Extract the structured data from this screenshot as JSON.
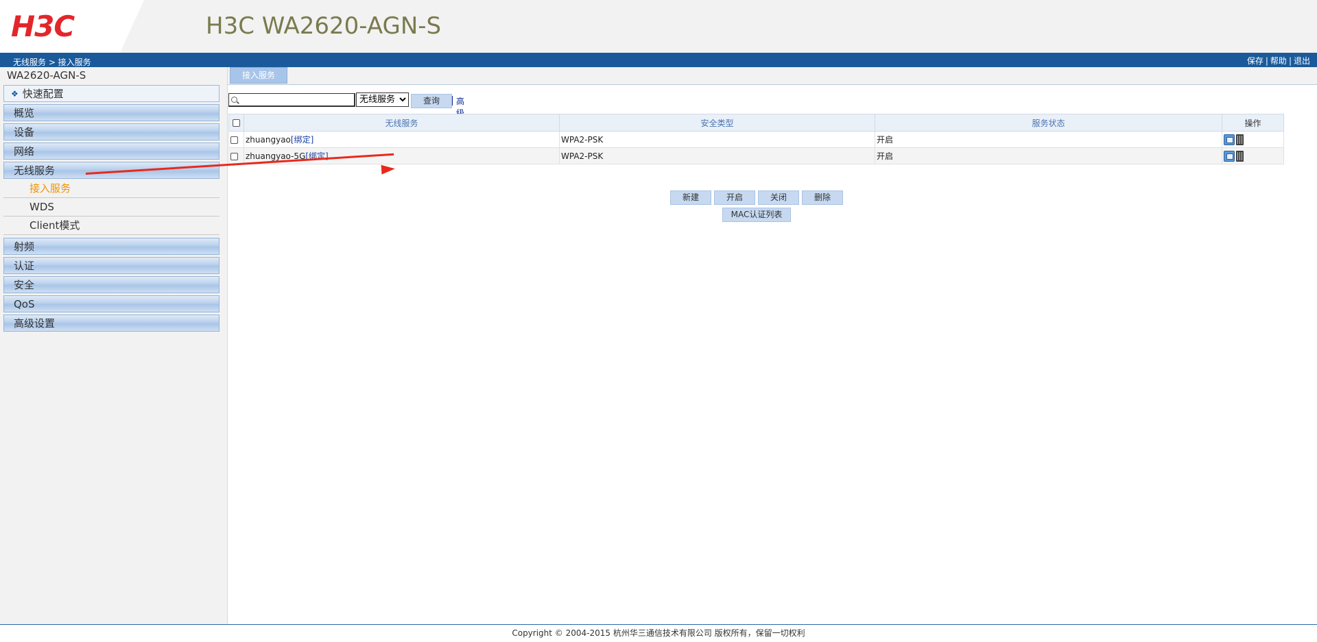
{
  "header": {
    "logo_text": "H3C",
    "title": "H3C WA2620-AGN-S",
    "breadcrumb": "无线服务 > 接入服务",
    "links": [
      "保存",
      "帮助",
      "退出"
    ]
  },
  "sidebar": {
    "device_name": "WA2620-AGN-S",
    "quick_config": "快速配置",
    "menu": {
      "overview": "概览",
      "device": "设备",
      "network": "网络",
      "wireless": "无线服务",
      "radio": "射频",
      "auth": "认证",
      "security": "安全",
      "qos": "QoS",
      "advanced": "高级设置"
    },
    "submenu": [
      "接入服务",
      "WDS",
      "Client模式"
    ],
    "active_submenu": "接入服务"
  },
  "main": {
    "tab": "接入服务",
    "search": {
      "value": "",
      "select_value": "无线服务",
      "query_button": "查询",
      "advanced_query": "高级查询"
    },
    "table": {
      "headers": [
        "无线服务",
        "安全类型",
        "服务状态",
        "操作"
      ],
      "rows": [
        {
          "service": "zhuangyao",
          "bind": "[绑定]",
          "security": "WPA2-PSK",
          "status": "开启"
        },
        {
          "service": "zhuangyao-5G",
          "bind": "[绑定]",
          "security": "WPA2-PSK",
          "status": "开启"
        }
      ]
    },
    "buttons": {
      "new": "新建",
      "enable": "开启",
      "disable": "关闭",
      "delete": "删除",
      "mac_list": "MAC认证列表"
    }
  },
  "footer": {
    "copyright": "Copyright © 2004-2015 杭州华三通信技术有限公司 版权所有，保留一切权利"
  },
  "colors": {
    "brand_red": "#e3262b",
    "header_blue": "#1a5a9a",
    "active_orange": "#f39200",
    "annotation_arrow": "#e8291c"
  }
}
